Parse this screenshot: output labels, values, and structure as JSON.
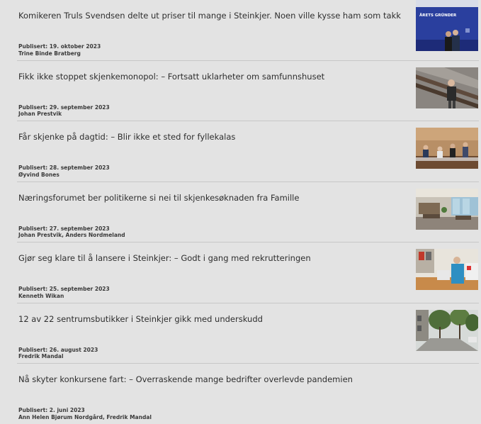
{
  "articles": [
    {
      "title": "Komikeren Truls Svendsen delte ut priser til mange i Steinkjer. Noen ville kysse ham som takk",
      "published": "Publisert: 19. oktober 2023",
      "author": "Trine Binde Bratberg",
      "image_caption": "ÅRETS GRÜNDER",
      "image_icon": "award-ceremony-photo"
    },
    {
      "title": "Fikk ikke stoppet skjenkemonopol: – Fortsatt uklarheter om samfunnshuset",
      "published": "Publisert: 29. september 2023",
      "author": "Johan Prestvik",
      "image_icon": "man-on-stairs-photo"
    },
    {
      "title": "Får skjenke på dagtid: – Blir ikke et sted for fyllekalas",
      "published": "Publisert: 28. september 2023",
      "author": "Øyvind Bones",
      "image_icon": "meeting-room-photo"
    },
    {
      "title": "Næringsforumet ber politikerne si nei til skjenkesøknaden fra Famille",
      "published": "Publisert: 27. september 2023",
      "author": "Johan Prestvik, Anders Nordmeland",
      "image_icon": "cafe-interior-photo"
    },
    {
      "title": "Gjør seg klare til å lansere i Steinkjer: – Godt i gang med rekrutteringen",
      "published": "Publisert: 25. september 2023",
      "author": "Kenneth Wikan",
      "image_icon": "shop-worker-photo"
    },
    {
      "title": "12 av 22 sentrumsbutikker i Steinkjer gikk med underskudd",
      "published": "Publisert: 26. august 2023",
      "author": "Fredrik Mandal",
      "image_icon": "street-trees-photo"
    },
    {
      "title": "Nå skyter konkursene fart: – Overraskende mange bedrifter overlevde pandemien",
      "published": "Publisert: 2. juni 2023",
      "author": "Ann Helen Bjørum Nordgård, Fredrik Mandal"
    }
  ]
}
